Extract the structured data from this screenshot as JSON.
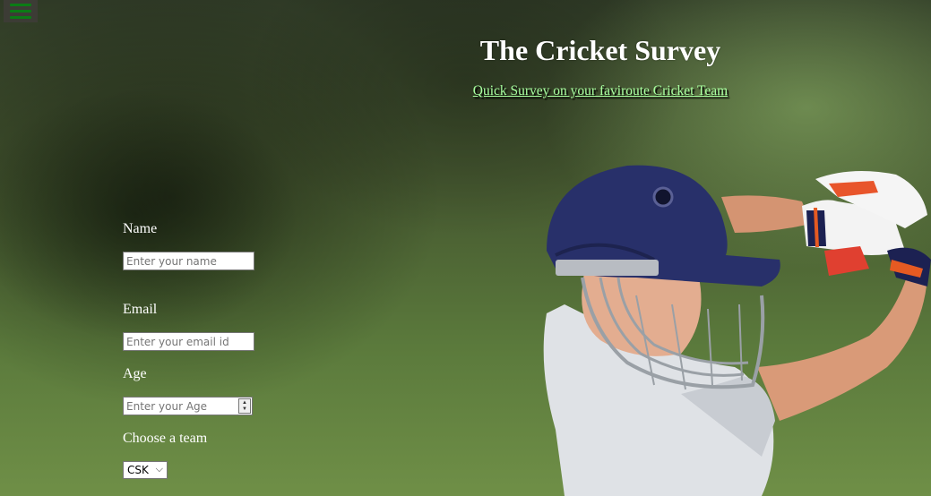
{
  "header": {
    "title": "The Cricket Survey",
    "subtitle": "Quick Survey on your faviroute Cricket Team"
  },
  "form": {
    "name": {
      "label": "Name",
      "placeholder": "Enter your name",
      "value": ""
    },
    "email": {
      "label": "Email",
      "placeholder": "Enter your email id",
      "value": ""
    },
    "age": {
      "label": "Age",
      "placeholder": "Enter your Age",
      "value": ""
    },
    "team": {
      "label": "Choose a team",
      "selected": "CSK"
    }
  },
  "menu": {
    "icon": "hamburger-menu-icon"
  },
  "colors": {
    "title": "#ffffff",
    "subtitle": "#a8ffa0",
    "menu_bars": "#0b7c15"
  }
}
